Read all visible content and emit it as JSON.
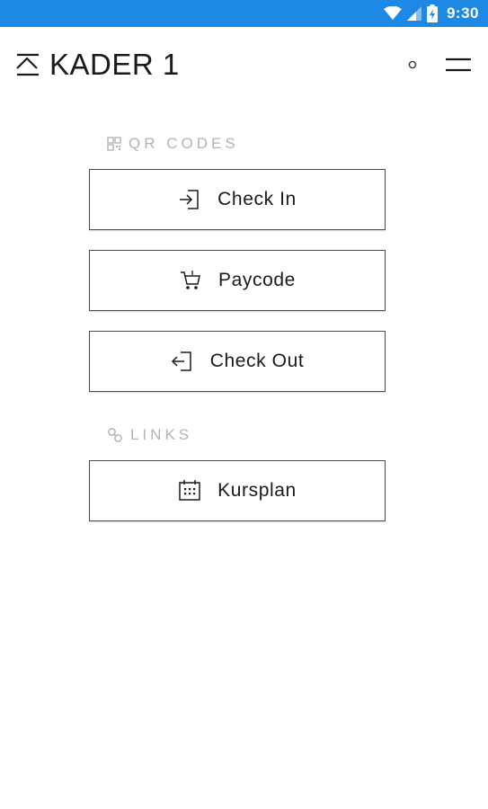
{
  "status_bar": {
    "time": "9:30",
    "icons": [
      "wifi-icon",
      "signal-icon",
      "battery-icon"
    ],
    "color": "#1e88e5"
  },
  "header": {
    "logo_text": "KADER 1",
    "logo_icon": "kader-logo-icon",
    "actions": [
      "circle-icon",
      "menu-icon"
    ]
  },
  "sections": {
    "qr_codes": {
      "label": "QR CODES",
      "icon": "qr-code-icon",
      "buttons": [
        {
          "label": "Check In",
          "icon": "sign-in-icon"
        },
        {
          "label": "Paycode",
          "icon": "cart-icon"
        },
        {
          "label": "Check Out",
          "icon": "sign-out-icon"
        }
      ]
    },
    "links": {
      "label": "LINKS",
      "icon": "link-icon",
      "buttons": [
        {
          "label": "Kursplan",
          "icon": "calendar-icon"
        }
      ]
    }
  }
}
